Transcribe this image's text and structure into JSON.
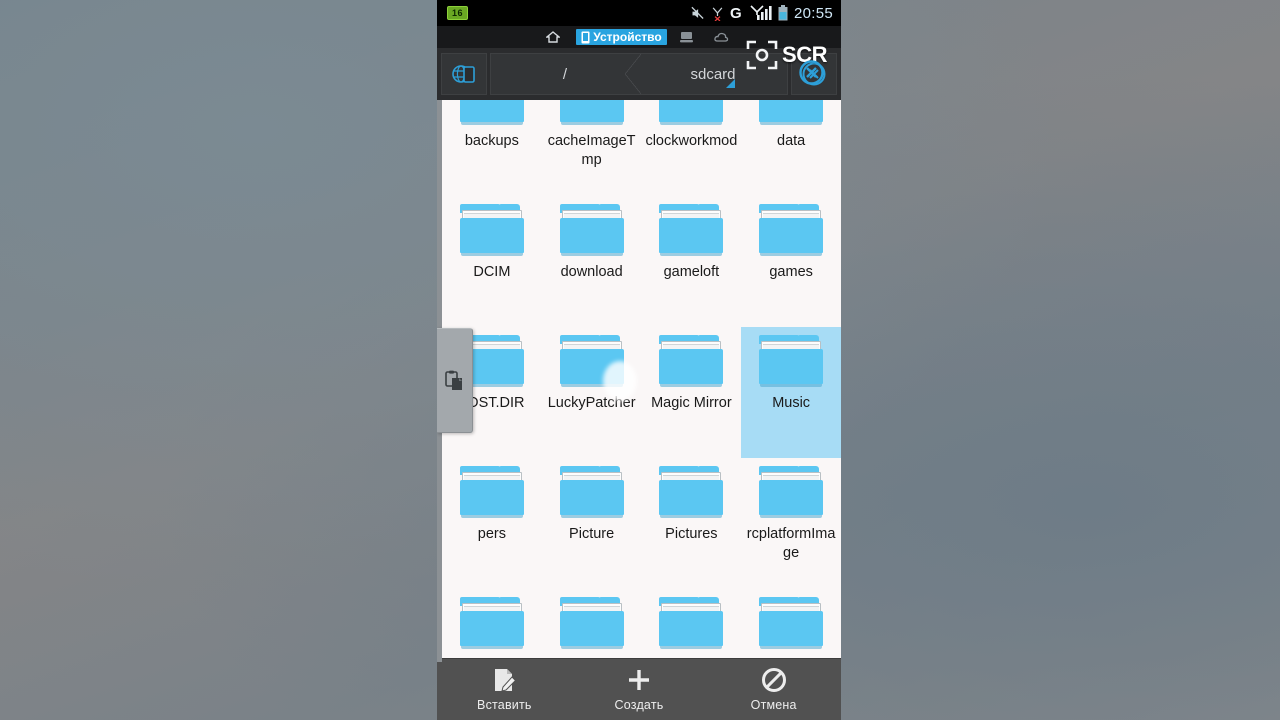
{
  "statusbar": {
    "battery_badge": "16",
    "clock": "20:55",
    "icons": [
      "mute-icon",
      "signal-cross-icon",
      "g-network-icon",
      "signal-bars-icon",
      "battery-icon"
    ]
  },
  "tabs": [
    {
      "id": "home",
      "icon": "home-icon",
      "label": "",
      "active": false
    },
    {
      "id": "device",
      "icon": "phone-icon",
      "label": "Устройство",
      "active": true
    },
    {
      "id": "pc",
      "icon": "computer-icon",
      "label": "",
      "active": false
    },
    {
      "id": "cloud",
      "icon": "cloud-icon",
      "label": "",
      "active": false
    }
  ],
  "pathbar": {
    "home_icon": "globe-phone-icon",
    "crumbs": [
      "/",
      "sdcard"
    ],
    "close_icon": "close-circle-icon"
  },
  "scr_overlay": {
    "label": "SCR",
    "record_icon": "camera-focus-icon",
    "stop_icon": "stop-x-icon"
  },
  "side_panel": {
    "icon": "paste-clipboard-icon"
  },
  "files": [
    {
      "name": "backups",
      "selected": false,
      "clipped_top": true
    },
    {
      "name": "cacheImageTmp",
      "selected": false,
      "clipped_top": true
    },
    {
      "name": "clockworkmod",
      "selected": false,
      "clipped_top": true
    },
    {
      "name": "data",
      "selected": false,
      "clipped_top": true
    },
    {
      "name": "DCIM",
      "selected": false,
      "clipped_top": false
    },
    {
      "name": "download",
      "selected": false,
      "clipped_top": false
    },
    {
      "name": "gameloft",
      "selected": false,
      "clipped_top": false
    },
    {
      "name": "games",
      "selected": false,
      "clipped_top": false
    },
    {
      "name": "LOST.DIR",
      "selected": false,
      "clipped_top": false
    },
    {
      "name": "LuckyPatcher",
      "selected": false,
      "clipped_top": false
    },
    {
      "name": "Magic Mirror",
      "selected": false,
      "clipped_top": false
    },
    {
      "name": "Music",
      "selected": true,
      "clipped_top": false
    },
    {
      "name": "pers",
      "selected": false,
      "clipped_top": false
    },
    {
      "name": "Picture",
      "selected": false,
      "clipped_top": false
    },
    {
      "name": "Pictures",
      "selected": false,
      "clipped_top": false
    },
    {
      "name": "rcplatformImage",
      "selected": false,
      "clipped_top": false
    },
    {
      "name": "",
      "selected": false,
      "clipped_top": false
    },
    {
      "name": "",
      "selected": false,
      "clipped_top": false
    },
    {
      "name": "",
      "selected": false,
      "clipped_top": false
    },
    {
      "name": "",
      "selected": false,
      "clipped_top": false
    }
  ],
  "bottombar": [
    {
      "id": "paste",
      "label": "Вставить",
      "icon": "paste-file-icon"
    },
    {
      "id": "create",
      "label": "Создать",
      "icon": "plus-icon"
    },
    {
      "id": "cancel",
      "label": "Отмена",
      "icon": "cancel-icon"
    }
  ],
  "colors": {
    "folder_blue": "#5bc7f2",
    "selection_blue": "#a7dcf5",
    "tab_active": "#29a4e0",
    "bottom_bar": "#515151"
  }
}
